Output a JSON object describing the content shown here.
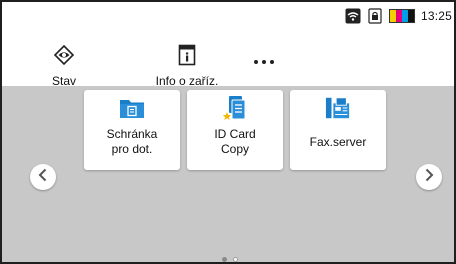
{
  "status_bar": {
    "wifi_icon": "wifi-icon",
    "lock_icon": "lock-icon",
    "toner_colors": [
      "#f5d000",
      "#e6007e",
      "#00a0e9",
      "#111111"
    ],
    "time": "13:25"
  },
  "nav": {
    "stav": {
      "label": "Stav",
      "icon": "status-eye-icon"
    },
    "info": {
      "label": "Info o zaříz.",
      "icon": "device-info-icon"
    },
    "more": {
      "icon": "more-dots-icon"
    }
  },
  "home": {
    "background": "#c8c8c8",
    "tiles": [
      {
        "line1": "Schránka",
        "line2": "pro dot.",
        "icon": "folder-document-icon",
        "color": "#1a7ec8"
      },
      {
        "line1": "ID Card",
        "line2": "Copy",
        "icon": "id-card-copy-icon",
        "color": "#1a7ec8"
      },
      {
        "line1": "Fax.server",
        "icon": "fax-server-icon",
        "color": "#1a7ec8"
      }
    ],
    "pager": {
      "pages": 2,
      "current": 1
    }
  }
}
